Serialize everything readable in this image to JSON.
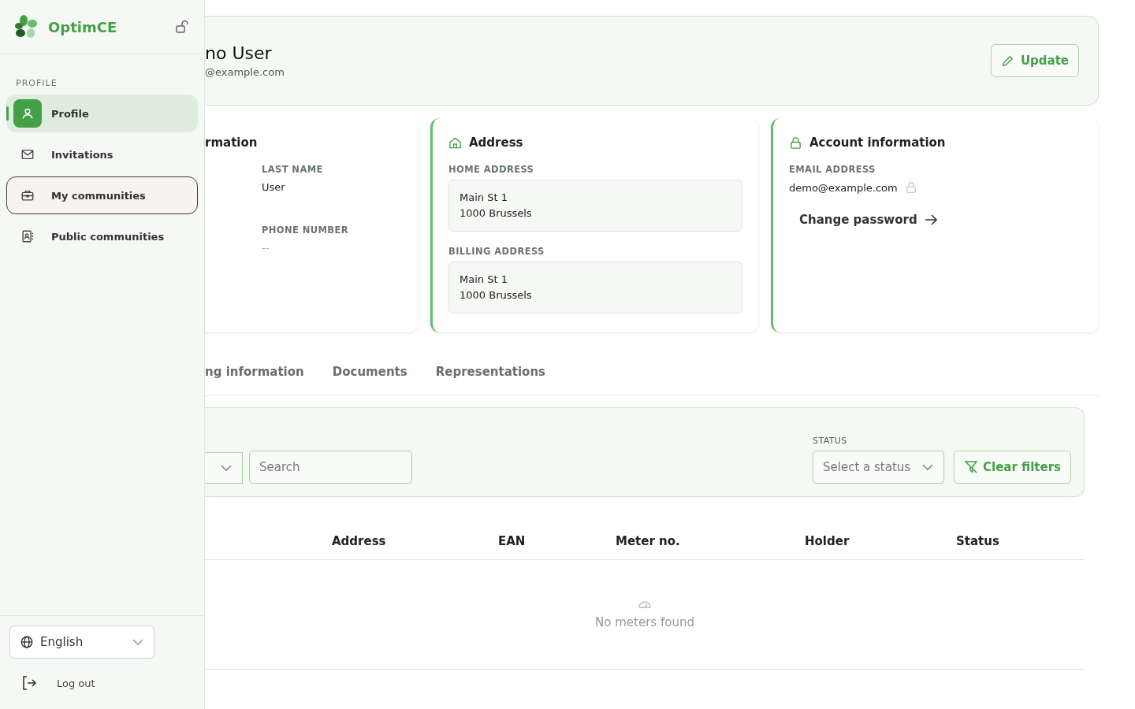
{
  "sidebar": {
    "brand": "OptimCE",
    "section": "PROFILE",
    "items": [
      {
        "label": "Profile",
        "selected": true,
        "focused": false
      },
      {
        "label": "Invitations",
        "selected": false,
        "focused": false
      },
      {
        "label": "My communities",
        "selected": false,
        "focused": true
      },
      {
        "label": "Public communities",
        "selected": false,
        "focused": false
      }
    ],
    "language": "English",
    "logout": "Log out"
  },
  "header": {
    "name": "no User",
    "email": "@example.com",
    "update": "Update"
  },
  "cards": {
    "personal": {
      "title": "rmation",
      "fields": [
        {
          "label": "LAST NAME",
          "value": "User"
        },
        {
          "label": "PHONE NUMBER",
          "value": "--"
        }
      ]
    },
    "address": {
      "title": "Address",
      "fields": [
        {
          "label": "HOME ADDRESS",
          "lines": [
            "Main St 1",
            "1000 Brussels"
          ]
        },
        {
          "label": "BILLING ADDRESS",
          "lines": [
            "Main St 1",
            "1000 Brussels"
          ]
        }
      ]
    },
    "account": {
      "title": "Account information",
      "email_label": "EMAIL ADDRESS",
      "email": "demo@example.com",
      "change_password": "Change password"
    }
  },
  "tabs": [
    {
      "label": "ng information",
      "selected": false
    },
    {
      "label": "Documents",
      "selected": false
    },
    {
      "label": "Representations",
      "selected": false
    }
  ],
  "filters": {
    "search_placeholder": "Search",
    "status_label": "STATUS",
    "status_placeholder": "Select a status",
    "clear": "Clear filters"
  },
  "table": {
    "columns": [
      "Address",
      "EAN",
      "Meter no.",
      "Holder",
      "Status"
    ],
    "empty": "No meters found"
  }
}
